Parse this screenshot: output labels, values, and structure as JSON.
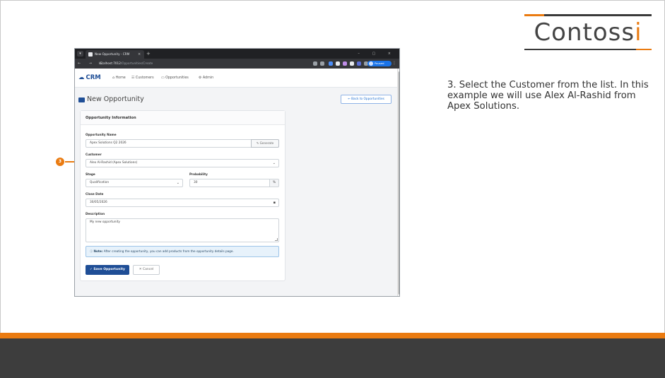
{
  "brand": {
    "name_main": "Contoss",
    "name_accent": "i"
  },
  "instruction": {
    "text": "3. Select the Customer from the list. In this example we will use Alex Al-Rashid from Apex Solutions."
  },
  "callout": {
    "number": "3"
  },
  "colors": {
    "accent": "#ea7b11",
    "primary": "#1f4e96",
    "footer": "#3d3d3d"
  },
  "browser": {
    "tab_title": "New Opportunity - CRM",
    "tab_close": "×",
    "new_tab": "+",
    "window_controls": "–  ▢  ×",
    "nav_glyphs": "←  →  C",
    "url_host": "localhost:7012",
    "url_path": "/Opportunities/Create",
    "profile_label": "Paused",
    "menu_dots": "⋮"
  },
  "app": {
    "logo": "CRM",
    "logo_icon": "☁",
    "nav": [
      {
        "icon": "⌂",
        "label": "Home"
      },
      {
        "icon": "☷",
        "label": "Customers"
      },
      {
        "icon": "▭",
        "label": "Opportunities"
      },
      {
        "icon": "⚙",
        "label": "Admin"
      }
    ],
    "page_title": "New Opportunity",
    "back_label": "← Back to Opportunities",
    "card_title": "Opportunity Information",
    "form": {
      "name_label": "Opportunity Name",
      "name_value": "Apex Solutions Q2 2026",
      "generate_label": "✎ Generate",
      "customer_label": "Customer",
      "customer_value": "Alex Al-Rashid (Apex Solutions)",
      "stage_label": "Stage",
      "stage_value": "Qualification",
      "probability_label": "Probability",
      "probability_value": "30",
      "probability_unit": "%",
      "close_date_label": "Close Date",
      "close_date_value": "30/05/2026",
      "description_label": "Description",
      "description_value": "My new opportunity",
      "note_strong": "Note:",
      "note_text": " After creating the opportunity, you can add products from the opportunity details page.",
      "note_icon": "ⓘ",
      "save_label": "✓ Save Opportunity",
      "cancel_label": "✕ Cancel",
      "select_caret": "⌄",
      "calendar_glyph": "▪"
    }
  }
}
